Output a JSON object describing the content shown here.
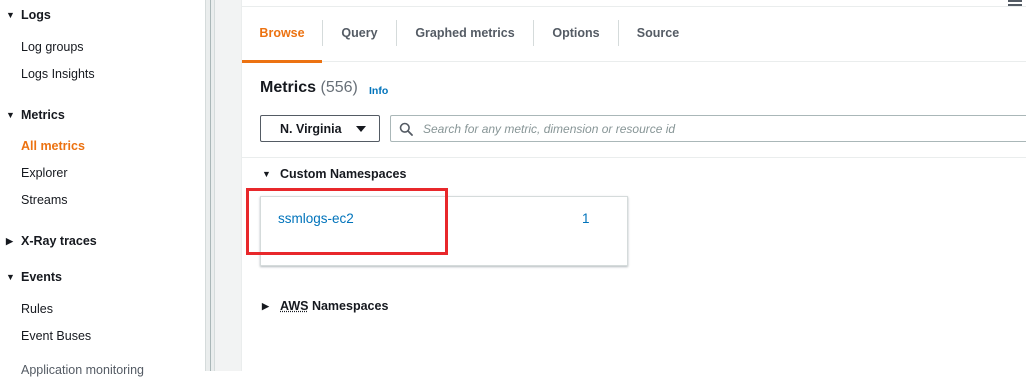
{
  "sidebar": {
    "sections": [
      {
        "label": "Logs",
        "expanded": true,
        "items": [
          "Log groups",
          "Logs Insights"
        ]
      },
      {
        "label": "Metrics",
        "expanded": true,
        "items": [
          "All metrics",
          "Explorer",
          "Streams"
        ],
        "active_item": "All metrics"
      },
      {
        "label": "X-Ray traces",
        "expanded": false,
        "items": []
      },
      {
        "label": "Events",
        "expanded": true,
        "items": [
          "Rules",
          "Event Buses"
        ]
      }
    ],
    "cutoff_item": "Application monitoring"
  },
  "tabs": [
    {
      "label": "Browse",
      "active": true
    },
    {
      "label": "Query",
      "active": false
    },
    {
      "label": "Graphed metrics",
      "active": false
    },
    {
      "label": "Options",
      "active": false
    },
    {
      "label": "Source",
      "active": false
    }
  ],
  "metrics_header": {
    "title": "Metrics",
    "count": "(556)",
    "info_label": "Info"
  },
  "region_select": {
    "value": "N. Virginia"
  },
  "search": {
    "placeholder": "Search for any metric, dimension or resource id",
    "value": ""
  },
  "namespaces": {
    "custom_header": "Custom Namespaces",
    "custom_items": [
      {
        "name": "ssmlogs-ec2",
        "count": "1"
      }
    ],
    "aws_header_prefix": "AWS",
    "aws_header_suffix": " Namespaces"
  },
  "colors": {
    "accent": "#ec7211",
    "link": "#0073bb",
    "highlight": "#e8282b"
  }
}
